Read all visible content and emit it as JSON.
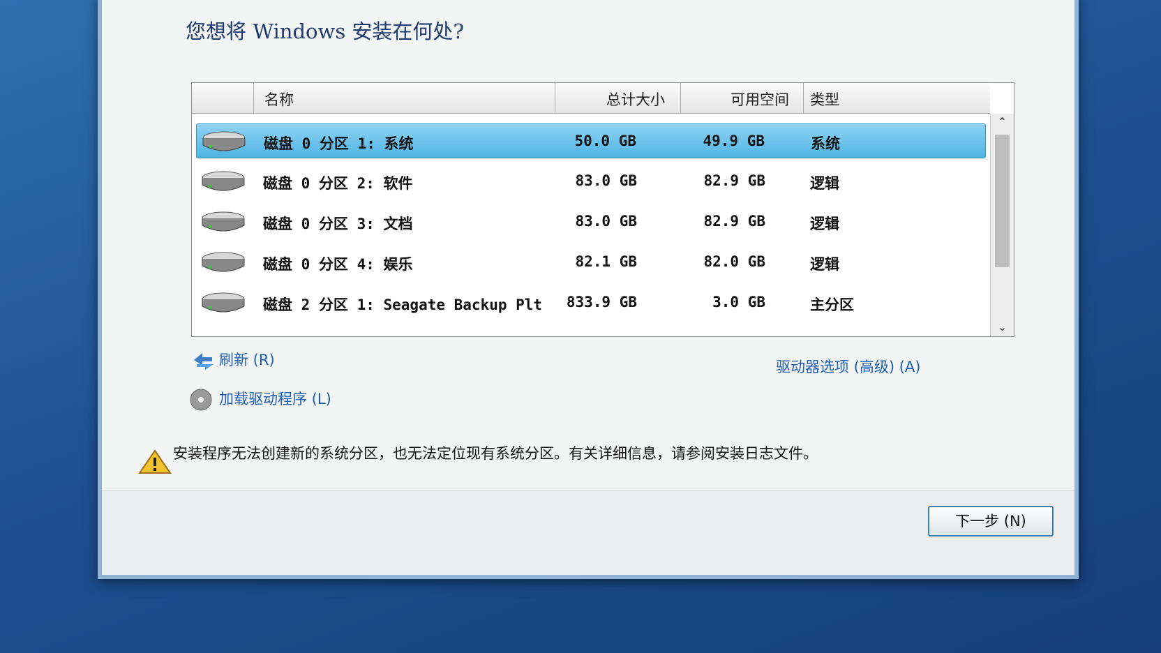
{
  "title": "您想将 Windows 安装在何处?",
  "table": {
    "headers": {
      "name": "名称",
      "total": "总计大小",
      "free": "可用空间",
      "type": "类型"
    },
    "rows": [
      {
        "name": "磁盘 0 分区 1: 系统",
        "total": "50.0 GB",
        "free": "49.9 GB",
        "type": "系统",
        "selected": true
      },
      {
        "name": "磁盘 0 分区 2: 软件",
        "total": "83.0 GB",
        "free": "82.9 GB",
        "type": "逻辑"
      },
      {
        "name": "磁盘 0 分区 3: 文档",
        "total": "83.0 GB",
        "free": "82.9 GB",
        "type": "逻辑"
      },
      {
        "name": "磁盘 0 分区 4: 娱乐",
        "total": "82.1 GB",
        "free": "82.0 GB",
        "type": "逻辑"
      },
      {
        "name": "磁盘 2 分区 1: Seagate Backup Plt",
        "total": "833.9 GB",
        "free": "3.0 GB",
        "type": "主分区"
      }
    ]
  },
  "links": {
    "refresh": "刷新 (R)",
    "load_driver": "加载驱动程序 (L)",
    "drive_options": "驱动器选项 (高级) (A)"
  },
  "warning": "安装程序无法创建新的系统分区，也无法定位现有系统分区。有关详细信息，请参阅安装日志文件。",
  "buttons": {
    "next": "下一步 (N)"
  },
  "colors": {
    "selection": "#4fb4e4",
    "link": "#1c5fb3"
  }
}
